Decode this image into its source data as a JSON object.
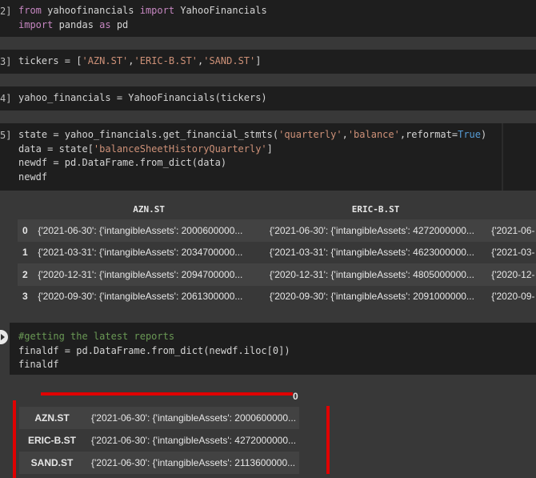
{
  "cells": [
    {
      "prompt": "2]",
      "lines": [
        [
          [
            "kw",
            "from"
          ],
          [
            "fn",
            " yahoofinancials "
          ],
          [
            "kw",
            "import"
          ],
          [
            "fn",
            " YahooFinancials"
          ]
        ],
        [
          [
            "kw",
            "import"
          ],
          [
            "fn",
            " pandas "
          ],
          [
            "kw",
            "as"
          ],
          [
            "fn",
            " pd"
          ]
        ]
      ]
    },
    {
      "prompt": "3]",
      "lines": [
        [
          [
            "fn",
            "tickers = ["
          ],
          [
            "str",
            "'AZN.ST'"
          ],
          [
            "fn",
            ","
          ],
          [
            "str",
            "'ERIC-B.ST'"
          ],
          [
            "fn",
            ","
          ],
          [
            "str",
            "'SAND.ST'"
          ],
          [
            "fn",
            "]"
          ]
        ]
      ]
    },
    {
      "prompt": "4]",
      "lines": [
        [
          [
            "fn",
            "yahoo_financials = YahooFinancials(tickers)"
          ]
        ]
      ]
    },
    {
      "prompt": "5]",
      "lines": [
        [
          [
            "fn",
            "state = yahoo_financials.get_financial_stmts("
          ],
          [
            "str",
            "'quarterly'"
          ],
          [
            "fn",
            ","
          ],
          [
            "str",
            "'balance'"
          ],
          [
            "fn",
            ",reformat="
          ],
          [
            "num",
            "True"
          ],
          [
            "fn",
            ")"
          ]
        ],
        [
          [
            "fn",
            "data = state["
          ],
          [
            "str",
            "'balanceSheetHistoryQuarterly'"
          ],
          [
            "fn",
            "]"
          ]
        ],
        [
          [
            "fn",
            "newdf = pd.DataFrame.from_dict(data)"
          ]
        ],
        [
          [
            "fn",
            "newdf"
          ]
        ]
      ]
    },
    {
      "prompt": "",
      "lines": [
        [
          [
            "comment",
            "#getting the latest reports"
          ]
        ],
        [
          [
            "fn",
            "finaldf = pd.DataFrame.from_dict(newdf.iloc[0])"
          ]
        ],
        [
          [
            "fn",
            "finaldf"
          ]
        ]
      ]
    }
  ],
  "newdf": {
    "columns": [
      "AZN.ST",
      "ERIC-B.ST"
    ],
    "rows": [
      {
        "index": "0",
        "cells": [
          "{'2021-06-30': {'intangibleAssets': 2000600000...",
          "{'2021-06-30': {'intangibleAssets': 4272000000...",
          "{'2021-06-"
        ]
      },
      {
        "index": "1",
        "cells": [
          "{'2021-03-31': {'intangibleAssets': 2034700000...",
          "{'2021-03-31': {'intangibleAssets': 4623000000...",
          "{'2021-03-"
        ]
      },
      {
        "index": "2",
        "cells": [
          "{'2020-12-31': {'intangibleAssets': 2094700000...",
          "{'2020-12-31': {'intangibleAssets': 4805000000...",
          "{'2020-12-"
        ]
      },
      {
        "index": "3",
        "cells": [
          "{'2020-09-30': {'intangibleAssets': 2061300000...",
          "{'2020-09-30': {'intangibleAssets': 2091000000...",
          "{'2020-09-"
        ]
      }
    ]
  },
  "finaldf": {
    "column": "0",
    "rows": [
      {
        "index": "AZN.ST",
        "value": "{'2021-06-30': {'intangibleAssets': 2000600000..."
      },
      {
        "index": "ERIC-B.ST",
        "value": "{'2021-06-30': {'intangibleAssets': 4272000000..."
      },
      {
        "index": "SAND.ST",
        "value": "{'2021-06-30': {'intangibleAssets': 2113600000..."
      }
    ]
  },
  "colors": {
    "annotation_red": "#e00000",
    "background": "#383838",
    "code_bg": "#1e1e1e"
  }
}
